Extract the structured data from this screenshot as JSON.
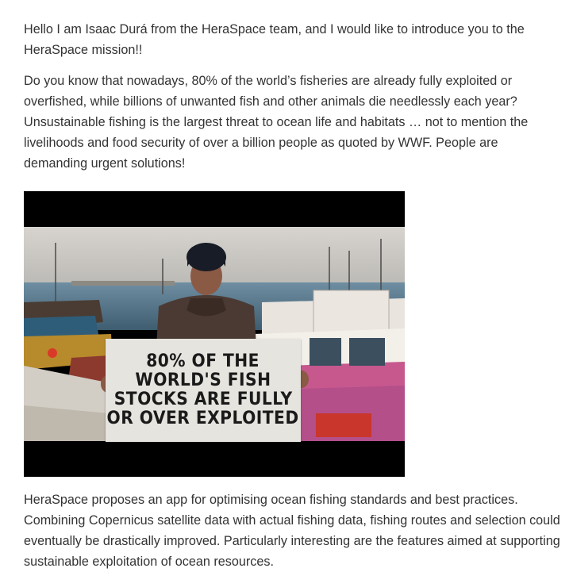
{
  "paragraphs": {
    "intro": "Hello I am Isaac Durá from the HeraSpace team, and I would like to introduce you to the HeraSpace mission!!",
    "fisheries": "Do you know that nowadays, 80% of the world’s fisheries are already fully exploited or overfished, while billions of unwanted fish and other animals die needlessly each year? Unsustainable fishing is the largest threat to ocean life and habitats … not to mention the livelihoods and food security of over a billion people as quoted by WWF.  People are demanding urgent solutions!",
    "proposal": "HeraSpace proposes an app for optimising ocean fishing standards and best practices. Combining Copernicus satellite data with actual fishing data, fishing routes and selection could eventually be drastically improved. Particularly interesting are the features aimed at supporting sustainable exploitation of ocean resources."
  },
  "video": {
    "sign_lines": [
      "80% OF THE",
      "WORLD'S FISH",
      "STOCKS ARE FULLY",
      "OR OVER EXPLOITED"
    ]
  }
}
